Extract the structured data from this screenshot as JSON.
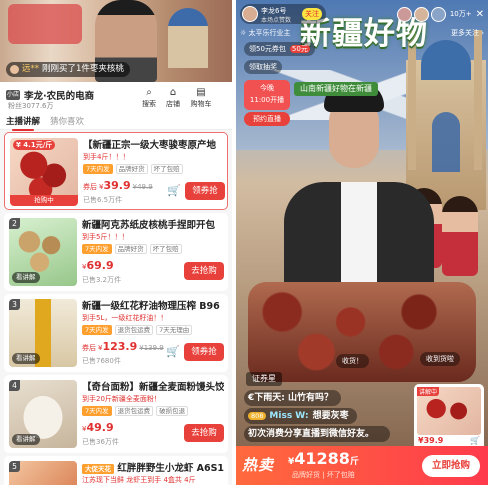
{
  "left": {
    "header": {
      "bought_user": "远**",
      "bought_text": "刚刚买了1件枣夹核桃"
    },
    "shop": {
      "logo": "小店",
      "name": "李龙·农民的电商",
      "sub": "粉丝3077.6万",
      "icons": [
        {
          "name": "search",
          "glyph": "⌕",
          "label": "搜索"
        },
        {
          "name": "store",
          "glyph": "⌂",
          "label": "店铺"
        },
        {
          "name": "orders",
          "glyph": "▤",
          "label": "购物车"
        }
      ]
    },
    "tabs": [
      {
        "label": "主播讲解",
        "active": true
      },
      {
        "label": "猜你喜欢",
        "active": false
      }
    ],
    "items": [
      {
        "idx": "1",
        "thumb_price": "¥ 4.1元/斤",
        "thumb_tag": "抢购中",
        "title": "【新疆正宗一级大枣骏枣原产地",
        "sub": "到手4斤！！！",
        "tags": [
          "7天内发",
          "品牌好货",
          "坏了包赔"
        ],
        "price_label": "券后",
        "price": "39.9",
        "old": "¥49.9",
        "sold": "已售6.5万件",
        "button": "领券抢"
      },
      {
        "idx": "2",
        "thumb_tag": "看讲解",
        "title": "新疆阿克苏纸皮核桃手捏即开包",
        "sub": "到手5斤！！！",
        "tags": [
          "7天内发",
          "品牌好货",
          "坏了包赔"
        ],
        "price_label": "",
        "price": "69.9",
        "old": "",
        "sold": "已售3.2万件",
        "button": "去抢购"
      },
      {
        "idx": "3",
        "thumb_tag": "看讲解",
        "title": "新疆一级红花籽油物理压榨 B96",
        "sub": "到手5L，一级红花籽油！！",
        "tags": [
          "7天内发",
          "退货包运费",
          "7天无理由"
        ],
        "price_label": "券后",
        "price": "123.9",
        "old": "¥139.9",
        "sold": "已售7680件",
        "button": "领券抢"
      },
      {
        "idx": "4",
        "thumb_tag": "看讲解",
        "title": "【奇台面粉】新疆全麦面粉馒头饺",
        "sub": "到手20斤新疆全麦面粉！",
        "tags": [
          "7天内发",
          "退货包运费",
          "破损包退"
        ],
        "price_label": "",
        "price": "49.9",
        "old": "",
        "sold": "已售36万件",
        "button": "去抢购"
      },
      {
        "idx": "5",
        "title": "红胖胖野生小龙虾 A6S1",
        "sub": "江苏现下当鲜 龙虾王到手 4盒共 4斤",
        "badge": "大促天花"
      }
    ]
  },
  "right": {
    "host": {
      "name": "李龙6号",
      "sub": "本场点赞数",
      "follow": "关注"
    },
    "viewers": {
      "count": "10万+"
    },
    "location": "☼ 太平乐行业主",
    "more": "更多关注 ›",
    "chip1": {
      "text": "领50元券包",
      "badge": "50元"
    },
    "chip2": "领取抽奖",
    "chip3": {
      "line1": "今晚",
      "line2": "11:00开播"
    },
    "chip4": "预约直播",
    "big_title": "新疆好物",
    "banner": "山南新疆好物在新疆",
    "float1": "收货！",
    "float2": "收到货啦",
    "notice": "证券星",
    "comments": [
      {
        "text": "€下雨天: 山竹有吗？"
      },
      {
        "level": "808",
        "user": "Miss W:",
        "text": "想要灰枣"
      },
      {
        "text": "初次消费分享直播到微信好友。"
      }
    ],
    "card": {
      "badge": "讲解中",
      "price": "¥39.9",
      "cart": "🛒"
    },
    "bottom": {
      "hot": "热卖",
      "price_prefix": "¥",
      "price": "41288",
      "unit": "斤",
      "sub": "品牌好货 | 坏了包赔",
      "button": "立即抢购"
    }
  }
}
